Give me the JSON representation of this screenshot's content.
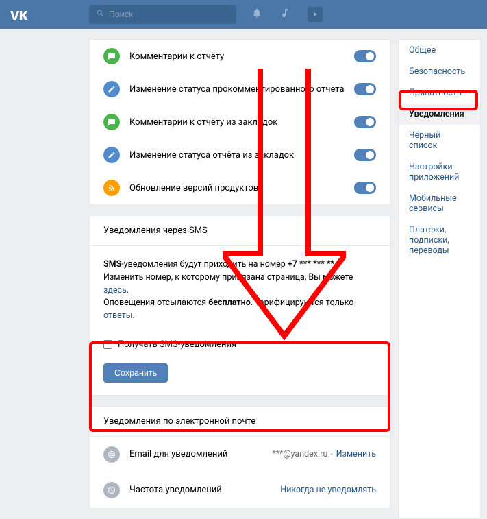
{
  "header": {
    "logo": "ᴠк",
    "search_placeholder": "Поиск"
  },
  "settings_rows": [
    {
      "label": "Комментарии к отчёту",
      "icon": "comment",
      "color": "green"
    },
    {
      "label": "Изменение статуса прокомментированного отчёта",
      "icon": "pencil",
      "color": "blue"
    },
    {
      "label": "Комментарии к отчёту из закладок",
      "icon": "comment",
      "color": "green"
    },
    {
      "label": "Изменение статуса отчёта из закладок",
      "icon": "pencil",
      "color": "blue"
    },
    {
      "label": "Обновление версий продуктов",
      "icon": "rss",
      "color": "orange"
    }
  ],
  "sms_section": {
    "title": "Уведомления через SMS",
    "prefix": "SMS",
    "text1": "-уведомления будут приходить на номер ",
    "phone": "+7 *** *** ** .",
    "text2": "Изменить номер, к которому привязана страница, Вы можете ",
    "here": "здесь",
    "text3": "Оповещения отсылаются ",
    "free": "бесплатно",
    "text4": ". Тарифицируются только ",
    "answers": "ответы",
    "checkbox_label": "Получать SMS-уведомления",
    "save_button": "Сохранить"
  },
  "email_section": {
    "title": "Уведомления по электронной почте",
    "rows": [
      {
        "label": "Email для уведомлений",
        "value": "***@yandex.ru",
        "link": "Изменить",
        "icon": "at"
      },
      {
        "label": "Частота уведомлений",
        "value": "",
        "link": "Никогда не уведомлять",
        "icon": "clock"
      }
    ]
  },
  "sidebar": {
    "items": [
      {
        "label": "Общее"
      },
      {
        "label": "Безопасность"
      },
      {
        "label": "Приватность"
      },
      {
        "label": "Уведомления",
        "active": true
      },
      {
        "label": "Чёрный список"
      },
      {
        "label": "Настройки приложений"
      },
      {
        "label": "Мобильные сервисы"
      },
      {
        "label": "Платежи, подписки, переводы"
      }
    ]
  }
}
